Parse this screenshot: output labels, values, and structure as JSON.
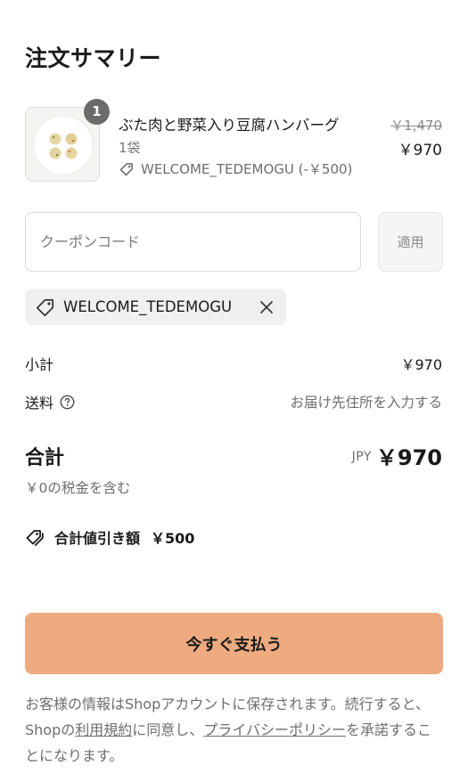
{
  "page": {
    "title": "注文サマリー"
  },
  "product": {
    "quantity": "1",
    "name": "ぶた肉と野菜入り豆腐ハンバーグ",
    "variant": "1袋",
    "discount_label": "WELCOME_TEDEMOGU (-￥500)",
    "original_price": "￥1,470",
    "price": "￥970"
  },
  "coupon": {
    "placeholder": "クーポンコード",
    "value": "",
    "apply_label": "適用",
    "applied_code": "WELCOME_TEDEMOGU"
  },
  "summary": {
    "subtotal_label": "小計",
    "subtotal_value": "￥970",
    "shipping_label": "送料",
    "shipping_value": "お届け先住所を入力する",
    "total_label": "合計",
    "total_currency": "JPY",
    "total_value": "￥970",
    "tax_note": "￥0の税金を含む",
    "savings_label": "合計値引き額",
    "savings_value": "￥500"
  },
  "actions": {
    "pay_label": "今すぐ支払う"
  },
  "legal": {
    "part1": "お客様の情報はShopアカウントに保存されます。続行すると、Shopの",
    "terms_link": "利用規約",
    "part2": "に同意し、",
    "privacy_link": "プライバシーポリシー",
    "part3": "を承諾することになります。"
  },
  "colors": {
    "pay_button": "#eeab80",
    "muted_text": "#6e6e6e",
    "chip_background": "#f0f0f0",
    "badge": "#6b6b6b"
  },
  "icons": {
    "product_discount": "tag-icon",
    "applied_code": "tag-icon",
    "remove": "close-icon",
    "shipping_help": "question-circle-icon",
    "savings": "double-tag-icon"
  }
}
